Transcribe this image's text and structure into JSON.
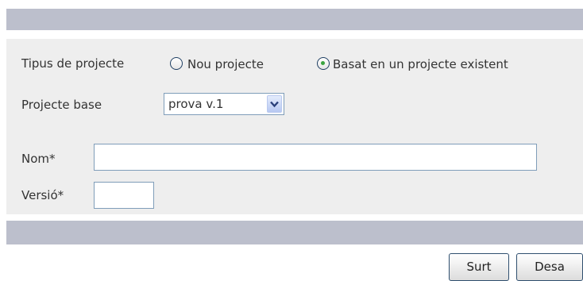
{
  "form": {
    "project_type": {
      "label": "Tipus de projecte",
      "options": [
        {
          "label": "Nou projecte",
          "selected": false
        },
        {
          "label": "Basat en un projecte existent",
          "selected": true
        }
      ]
    },
    "base_project": {
      "label": "Projecte base",
      "value": "prova v.1"
    },
    "name": {
      "label": "Nom*",
      "value": ""
    },
    "version": {
      "label": "Versió*",
      "value": ""
    }
  },
  "buttons": {
    "exit_label": "Surt",
    "save_label": "Desa"
  },
  "colors": {
    "header_bar": "#bcbfcc",
    "panel_background": "#eeeeee",
    "radio_selected_dot": "#3ba340"
  }
}
